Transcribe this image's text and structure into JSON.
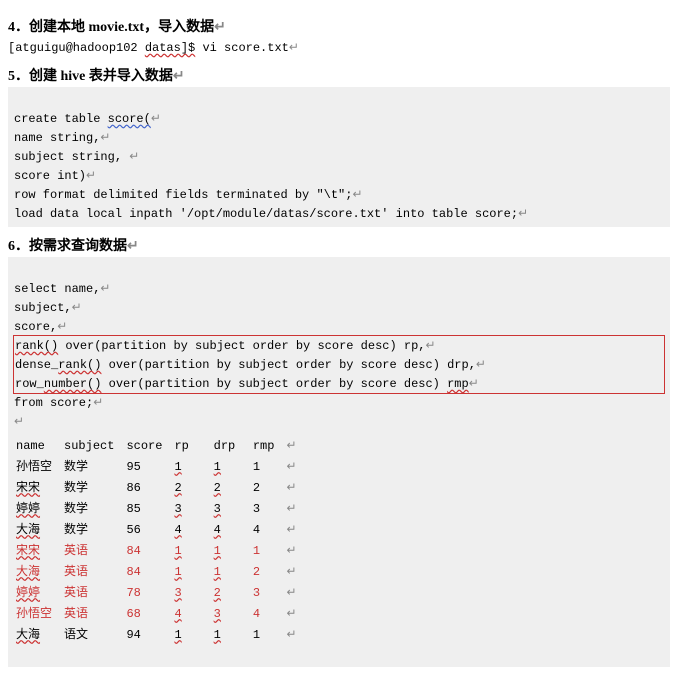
{
  "step4": {
    "heading": "4．创建本地 movie.txt，导入数据",
    "cmd_user": "[atguigu@hadoop102 ",
    "cmd_dir": "datas]$",
    "cmd_rest": " vi score.txt"
  },
  "step5": {
    "heading": "5．创建 hive 表并导入数据",
    "l1a": "create table ",
    "l1b": "score(",
    "l2": "name string,",
    "l3": "subject string, ",
    "l4": "score int)",
    "l5": "row format delimited fields terminated by \"\\t\";",
    "l6": "load data local inpath '/opt/module/datas/score.txt' into table score;"
  },
  "step6": {
    "heading": "6．按需求查询数据",
    "l1": "select name,",
    "l2": "subject,",
    "l3": "score,",
    "l4a": "rank()",
    "l4b": " over(partition by subject order by score desc) rp,",
    "l5a": "dense_",
    "l5b": "rank()",
    "l5c": " over(partition by subject order by score desc) drp,",
    "l6a": "row_",
    "l6b": "number()",
    "l6c": " over(partition by subject order by score desc) ",
    "l6d": "rmp",
    "l7": "from score;"
  },
  "cols": {
    "c0": "name",
    "c1": "subject",
    "c2": "score",
    "c3": "rp",
    "c4": "drp",
    "c5": "rmp"
  },
  "rows": [
    {
      "name": "孙悟空",
      "subject": "数学",
      "score": "95",
      "rp": "1",
      "drp": "1",
      "rmp": "1",
      "red": false
    },
    {
      "name": "宋宋",
      "subject": "数学",
      "score": "86",
      "rp": "2",
      "drp": "2",
      "rmp": "2",
      "red": false
    },
    {
      "name": "婷婷",
      "subject": "数学",
      "score": "85",
      "rp": "3",
      "drp": "3",
      "rmp": "3",
      "red": false
    },
    {
      "name": "大海",
      "subject": "数学",
      "score": "56",
      "rp": "4",
      "drp": "4",
      "rmp": "4",
      "red": false
    },
    {
      "name": "宋宋",
      "subject": "英语",
      "score": "84",
      "rp": "1",
      "drp": "1",
      "rmp": "1",
      "red": true
    },
    {
      "name": "大海",
      "subject": "英语",
      "score": "84",
      "rp": "1",
      "drp": "1",
      "rmp": "2",
      "red": true
    },
    {
      "name": "婷婷",
      "subject": "英语",
      "score": "78",
      "rp": "3",
      "drp": "2",
      "rmp": "3",
      "red": true
    },
    {
      "name": "孙悟空",
      "subject": "英语",
      "score": "68",
      "rp": "4",
      "drp": "3",
      "rmp": "4",
      "red": true
    },
    {
      "name": "大海",
      "subject": "语文",
      "score": "94",
      "rp": "1",
      "drp": "1",
      "rmp": "1",
      "red": false
    }
  ]
}
